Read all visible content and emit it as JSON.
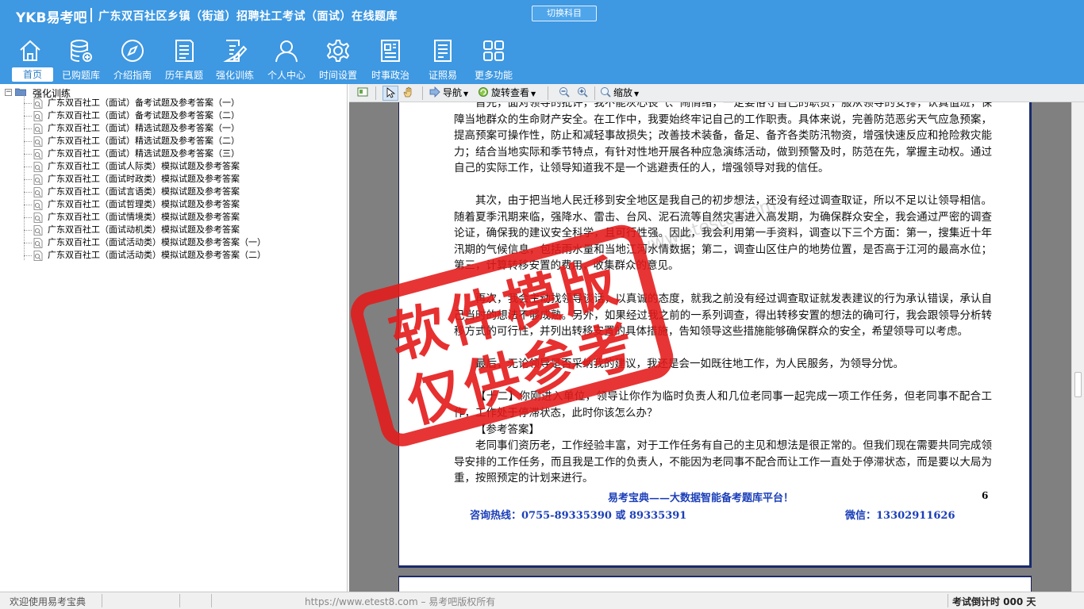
{
  "header": {
    "brand": "YKB易考吧",
    "title": "广东双百社区乡镇（街道）招聘社工考试（面试）在线题库",
    "switch_button": "切换科目"
  },
  "nav": {
    "items": [
      {
        "label": "首页",
        "icon": "home-icon"
      },
      {
        "label": "已购题库",
        "icon": "database-icon"
      },
      {
        "label": "介绍指南",
        "icon": "compass-icon"
      },
      {
        "label": "历年真题",
        "icon": "document-list-icon"
      },
      {
        "label": "强化训练",
        "icon": "edit-document-icon"
      },
      {
        "label": "个人中心",
        "icon": "user-icon"
      },
      {
        "label": "时间设置",
        "icon": "gear-icon"
      },
      {
        "label": "时事政治",
        "icon": "news-icon"
      },
      {
        "label": "证照易",
        "icon": "certificate-icon"
      },
      {
        "label": "更多功能",
        "icon": "grid-icon"
      }
    ]
  },
  "tree": {
    "root": "强化训练",
    "items": [
      "广东双百社工（面试）备考试题及参考答案（一）",
      "广东双百社工（面试）备考试题及参考答案（二）",
      "广东双百社工（面试）精选试题及参考答案（一）",
      "广东双百社工（面试）精选试题及参考答案（二）",
      "广东双百社工（面试）精选试题及参考答案（三）",
      "广东双百社工（面试人际类）模拟试题及参考答案",
      "广东双百社工（面试时政类）模拟试题及参考答案",
      "广东双百社工（面试言语类）模拟试题及参考答案",
      "广东双百社工（面试哲理类）模拟试题及参考答案",
      "广东双百社工（面试情境类）模拟试题及参考答案",
      "广东双百社工（面试动机类）模拟试题及参考答案",
      "广东双百社工（面试活动类）模拟试题及参考答案（一）",
      "广东双百社工（面试活动类）模拟试题及参考答案（二）"
    ]
  },
  "toolbar": {
    "nav_label": "导航",
    "rotate_label": "旋转查看",
    "zoom_label": "缩放"
  },
  "document": {
    "paragraphs": [
      "首先，面对领导的批评，我不能灰心丧气、闹情绪，一定要恪守自己的职责，服从领导的安排，认真值班，保障当地群众的生命财产安全。在工作中，我要始终牢记自己的工作职责。具体来说，完善防范恶劣天气应急预案，提高预案可操作性，防止和减轻事故损失；改善技术装备，备足、备齐各类防汛物资，增强快速反应和抢险救灾能力；结合当地实际和季节特点，有针对性地开展各种应急演练活动，做到预警及时，防范在先，掌握主动权。通过自己的实际工作，让领导知道我不是一个逃避责任的人，增强领导对我的信任。",
      "其次，由于把当地人民迁移到安全地区是我自己的初步想法，还没有经过调查取证，所以不足以让领导相信。随着夏季汛期来临，强降水、雷击、台风、泥石流等自然灾害进入高发期，为确保群众安全，我会通过严密的调查论证，确保我的建议安全科学，且可行性强。因此，我会利用第一手资料，调查以下三个方面：第一，搜集近十年汛期的气候信息，包括雨水量和当地江河水情数据；第二，调查山区住户的地势位置，是否高于江河的最高水位；第三，计算转移安置的费用，收集群众的意见。",
      "再次，我会主动找领导谈话，以真诚的态度，就我之前没有经过调查取证就发表建议的行为承认错误，承认自己当时的想法不够成熟。另外，如果经过我之前的一系列调查，得出转移安置的想法的确可行，我会跟领导分析转移方式的可行性，并列出转移安置的具体措施，告知领导这些措施能够确保群众的安全，希望领导可以考虑。",
      "最后，无论领导是否采纳我的建议，我还是会一如既往地工作，为人民服务，为领导分忧。",
      "【十二】你刚进入单位，领导让你作为临时负责人和几位老同事一起完成一项工作任务，但老同事不配合工作，工作处于停滞状态，此时你该怎么办？",
      "【参考答案】",
      "老同事们资历老，工作经验丰富，对于工作任务有自己的主见和想法是很正常的。但我们现在需要共同完成领导安排的工作任务，而且我是工作的负责人，不能因为老同事不配合而让工作一直处于停滞状态，而是要以大局为重，按照预定的计划来进行。"
    ],
    "page_number": "6",
    "footer_slogan": "易考宝典——大数据智能备考题库平台！",
    "footer_hotline": "咨询热线：0755-89335390 或 89335391",
    "footer_wechat": "微信：13302911626"
  },
  "watermark": {
    "stamp_line1": "软件模版",
    "stamp_line2": "仅供参考",
    "url": "www.etest8.com"
  },
  "status": {
    "welcome": "欢迎使用易考宝典",
    "url": "https://www.etest8.com – 易考吧版权所有",
    "countdown": "考试倒计时 000 天"
  },
  "colors": {
    "header_bg": "#3e98e2",
    "stamp_red": "#e41919",
    "footer_blue": "#1b3fb8"
  }
}
